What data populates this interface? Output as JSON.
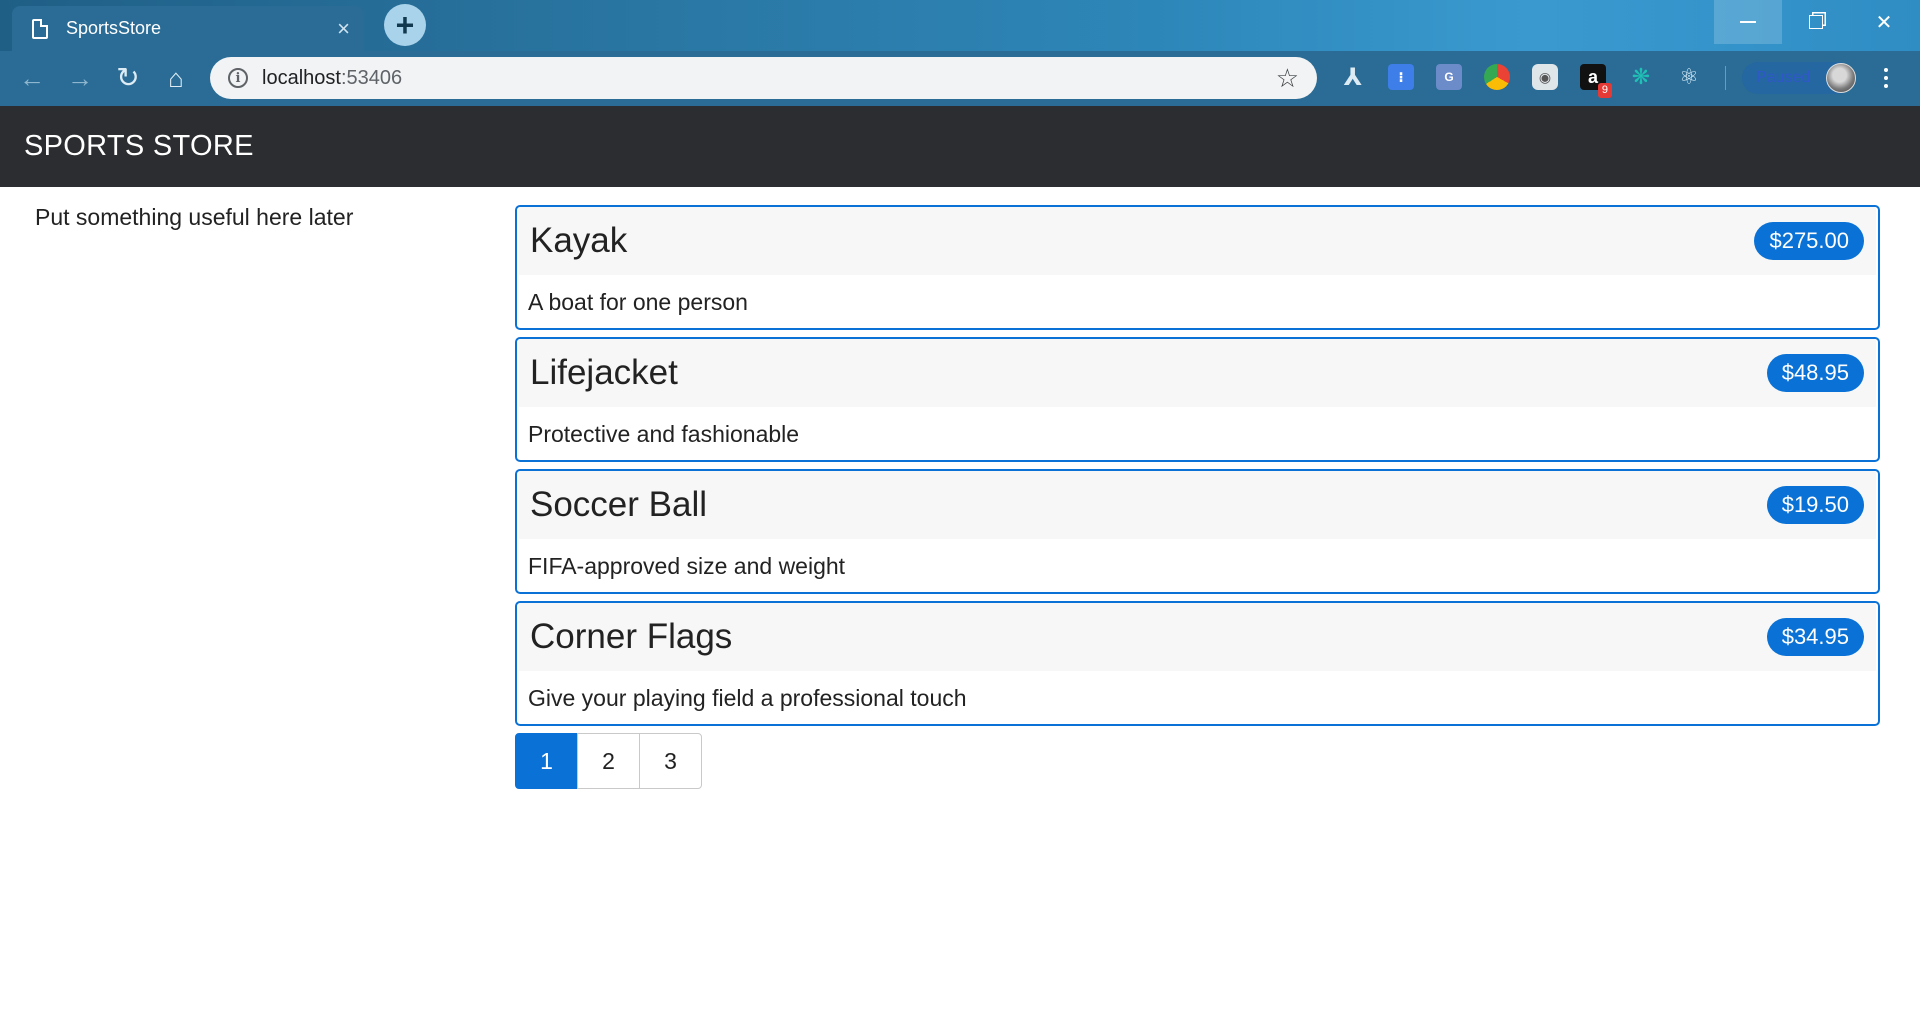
{
  "browser": {
    "tab_title": "SportsStore",
    "tab_close": "×",
    "new_tab": "+",
    "url_host": "localhost",
    "url_port": ":53406",
    "extensions": {
      "amazon_badge": "9",
      "paused_label": "Paused"
    },
    "icons": [
      "page-icon",
      "close-icon",
      "plus-icon",
      "back-icon",
      "forward-icon",
      "reload-icon",
      "home-icon",
      "info-icon",
      "star-icon",
      "menu-icon"
    ]
  },
  "app": {
    "brand": "SPORTS STORE",
    "sidebar_text": "Put something useful here later",
    "colors": {
      "primary": "#0a72d6",
      "navbar": "#2c2d30"
    },
    "products": [
      {
        "name": "Kayak",
        "price": "$275.00",
        "description": "A boat for one person"
      },
      {
        "name": "Lifejacket",
        "price": "$48.95",
        "description": "Protective and fashionable"
      },
      {
        "name": "Soccer Ball",
        "price": "$19.50",
        "description": "FIFA-approved size and weight"
      },
      {
        "name": "Corner Flags",
        "price": "$34.95",
        "description": "Give your playing field a professional touch"
      }
    ],
    "pagination": {
      "pages": [
        "1",
        "2",
        "3"
      ],
      "current": "1"
    }
  }
}
